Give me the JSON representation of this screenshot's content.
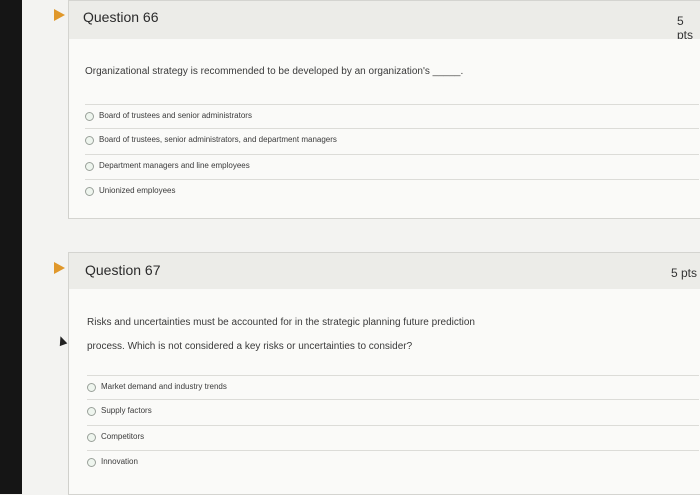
{
  "questions": [
    {
      "title": "Question 66",
      "points": "5 pts",
      "text_lines": [
        "Organizational strategy is recommended to be developed by an organization's _____."
      ],
      "answers": [
        "Board of trustees and senior administrators",
        "Board of trustees, senior administrators, and department managers",
        "Department managers and line employees",
        "Unionized employees"
      ]
    },
    {
      "title": "Question 67",
      "points": "5 pts",
      "text_lines": [
        "Risks and uncertainties must be accounted for in the strategic planning future prediction",
        "process. Which is not considered a key risks or uncertainties to consider?"
      ],
      "answers": [
        "Market demand and industry trends",
        "Supply factors",
        "Competitors",
        "Innovation"
      ]
    }
  ],
  "colors": {
    "marker": "#e0982b",
    "header_bg": "#ecece8",
    "body_bg": "#fafaf8"
  }
}
